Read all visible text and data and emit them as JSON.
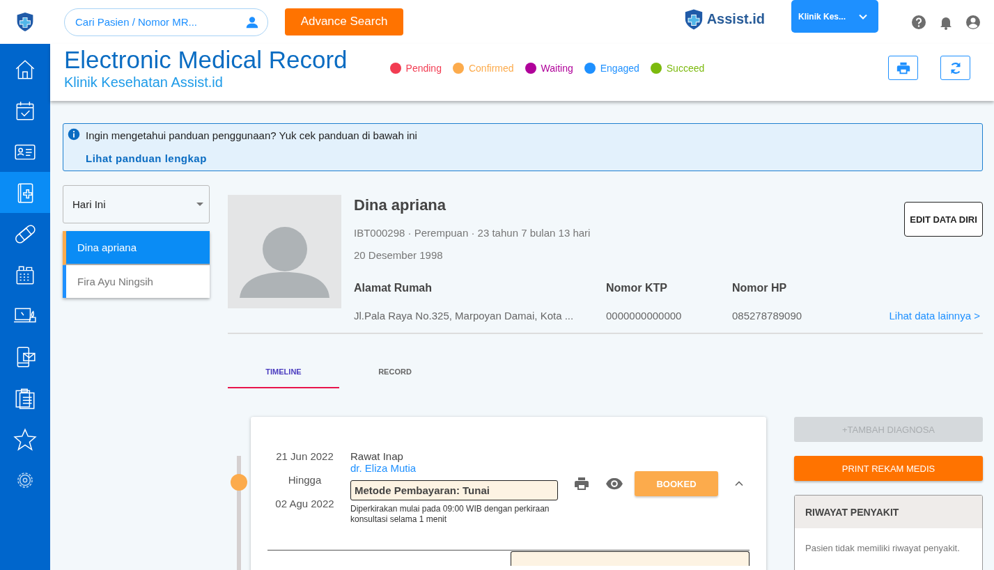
{
  "topbar": {
    "search_placeholder": "Cari Pasien / Nomor MR...",
    "advance_search": "Advance Search",
    "brand": "Assist.id",
    "clinic_select": "Klinik Kes..."
  },
  "sidebar": {
    "items": [
      {
        "selected": false
      },
      {
        "selected": false
      },
      {
        "selected": false
      },
      {
        "selected": true
      },
      {
        "selected": false
      },
      {
        "selected": false
      },
      {
        "selected": false
      },
      {
        "selected": false
      },
      {
        "selected": false
      },
      {
        "selected": false
      },
      {
        "selected": false
      }
    ]
  },
  "header": {
    "title": "Electronic Medical Record",
    "subtitle": "Klinik Kesehatan Assist.id",
    "legend": [
      {
        "label": "Pending",
        "color": "#f23c52"
      },
      {
        "label": "Confirmed",
        "color": "#fcab4c"
      },
      {
        "label": "Waiting",
        "color": "#b0029a"
      },
      {
        "label": "Engaged",
        "color": "#1e90ff"
      },
      {
        "label": "Succeed",
        "color": "#7cba0e"
      }
    ]
  },
  "banner": {
    "text": "Ingin mengetahui panduan penggunaan? Yuk cek panduan di bawah ini",
    "link": "Lihat panduan lengkap"
  },
  "filter": {
    "value": "Hari Ini"
  },
  "patients": [
    {
      "name": "Dina apriana",
      "selected": true
    },
    {
      "name": "Fira Ayu Ningsih",
      "selected": false
    }
  ],
  "profile": {
    "name": "Dina apriana",
    "summary": "IBT000298 · Perempuan · 23 tahun 7 bulan 13 hari",
    "birth_date": "20 Desember 1998",
    "edit_button": "EDIT DATA DIRI",
    "fields": [
      {
        "label": "Alamat Rumah",
        "value": "Jl.Pala Raya No.325, Marpoyan Damai, Kota ..."
      },
      {
        "label": "Nomor KTP",
        "value": "0000000000000"
      },
      {
        "label": "Nomor HP",
        "value": "085278789090"
      }
    ],
    "more_link": "Lihat data lainnya >"
  },
  "tabs": [
    {
      "label": "TIMELINE",
      "selected": true
    },
    {
      "label": "RECORD",
      "selected": false
    }
  ],
  "visit": {
    "start": "21 Jun 2022",
    "until": "Hingga",
    "end": "02 Agu 2022",
    "type": "Rawat Inap",
    "doctor": "dr. Eliza Mutia",
    "payment": "Metode Pembayaran: Tunai",
    "note": "Diperkirakan mulai pada 09:00 WIB dengan perkiraan konsultasi selama 1 menit",
    "status": "BOOKED",
    "expanded": true
  },
  "actions": [
    {
      "label": "+TAMBAH DIAGNOSA",
      "disabled": true
    },
    {
      "label": "PRINT REKAM MEDIS",
      "disabled": false
    }
  ],
  "history": {
    "title": "RIWAYAT PENYAKIT",
    "text": "Pasien tidak memiliki riwayat penyakit."
  }
}
